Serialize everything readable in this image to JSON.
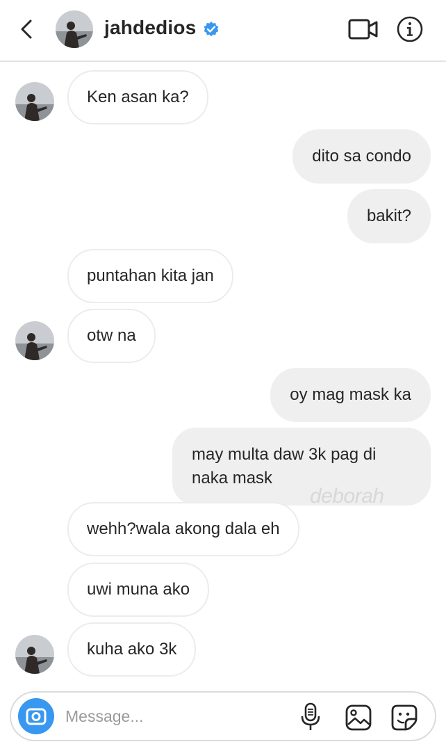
{
  "header": {
    "username": "jahdedios",
    "verified": true,
    "icons": [
      "back-arrow-icon",
      "avatar",
      "verified-badge-icon",
      "video-call-icon",
      "info-icon"
    ]
  },
  "messages": [
    {
      "from": "them",
      "text": "Ken asan ka?",
      "avatar": true
    },
    {
      "from": "me",
      "text": "dito sa condo"
    },
    {
      "from": "me",
      "text": "bakit?"
    },
    {
      "from": "them",
      "text": "puntahan kita jan",
      "avatar": false
    },
    {
      "from": "them",
      "text": "otw na",
      "avatar": true
    },
    {
      "from": "me",
      "text": "oy mag mask ka"
    },
    {
      "from": "me",
      "text": "may multa daw 3k pag di naka mask"
    },
    {
      "from": "them",
      "text": "wehh?wala akong dala eh",
      "avatar": false
    },
    {
      "from": "them",
      "text": "uwi muna ako",
      "avatar": false
    },
    {
      "from": "them",
      "text": "kuha ako 3k",
      "avatar": true
    }
  ],
  "watermark": "deborah",
  "composer": {
    "placeholder": "Message...",
    "icons": [
      "camera-icon",
      "microphone-icon",
      "gallery-icon",
      "sticker-icon"
    ]
  },
  "colors": {
    "incoming_bubble": "#ffffff",
    "outgoing_bubble": "#efefef",
    "verified_blue": "#3897f0",
    "camera_blue": "#3897f0"
  }
}
